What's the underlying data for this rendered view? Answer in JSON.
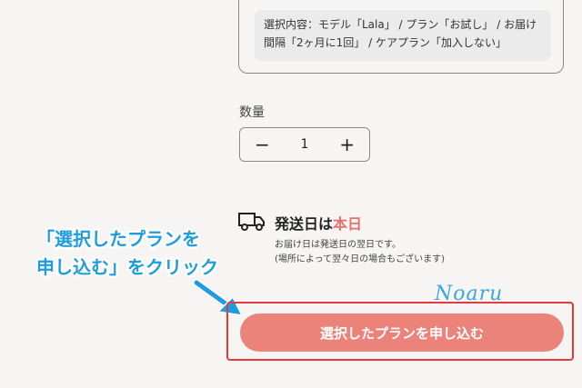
{
  "summary": {
    "line1": "選択内容：モデル「Lala」 / プラン「お試し」 / お届け",
    "line2": "間隔「2ヶ月に1回」 / ケアプラン「加入しない」"
  },
  "quantity": {
    "label": "数量",
    "minus": "−",
    "value": "1",
    "plus": "+"
  },
  "shipping": {
    "title_prefix": "発送日は",
    "title_highlight": "本日",
    "note_line1": "お届け日は発送日の翌日です。",
    "note_line2": "(場所によって翌々日の場合もございます)"
  },
  "callout": {
    "line1": "「選択したプランを",
    "line2": "申し込む」をクリック"
  },
  "watermark": "Noaru",
  "submit_button": "選択したプランを申し込む",
  "colors": {
    "accent": "#ec837a",
    "highlight_text": "#e5706a",
    "callout": "#1e9ce0",
    "frame": "#e53b3b"
  },
  "icons": {
    "truck": "truck-icon",
    "arrow": "arrow-icon"
  }
}
